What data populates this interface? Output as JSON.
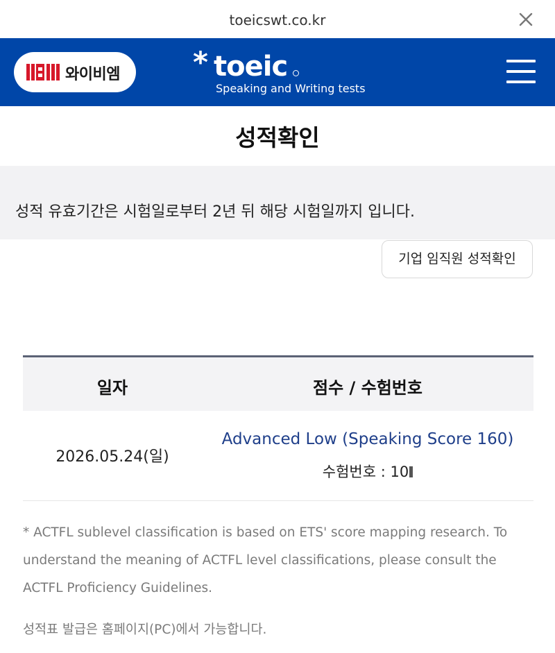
{
  "browser": {
    "url": "toeicswt.co.kr",
    "close_icon": "close-icon"
  },
  "header": {
    "ybm_label": "와이비엠",
    "toeic_wordmark": "toeic",
    "toeic_subtitle": "Speaking and Writing tests",
    "menu_icon": "hamburger-menu-icon",
    "brand_color": "#0046a8"
  },
  "page": {
    "title": "성적확인",
    "notice": "성적 유효기간은 시험일로부터 2년 뒤 해당 시험일까지 입니다.",
    "corporate_button": "기업 임직원 성적확인"
  },
  "table": {
    "headers": [
      "일자",
      "점수 / 수험번호"
    ],
    "rows": [
      {
        "date": "2026.05.24(일)",
        "level": "Advanced Low (Speaking Score 160)",
        "regno": "수험번호 : 10"
      }
    ]
  },
  "footnotes": {
    "actfl": "* ACTFL sublevel classification is based on ETS' score mapping research. To understand the meaning of ACTFL level classifications, please consult the ACTFL Proficiency Guidelines.",
    "issuance": "성적표 발급은 홈페이지(PC)에서 가능합니다."
  }
}
